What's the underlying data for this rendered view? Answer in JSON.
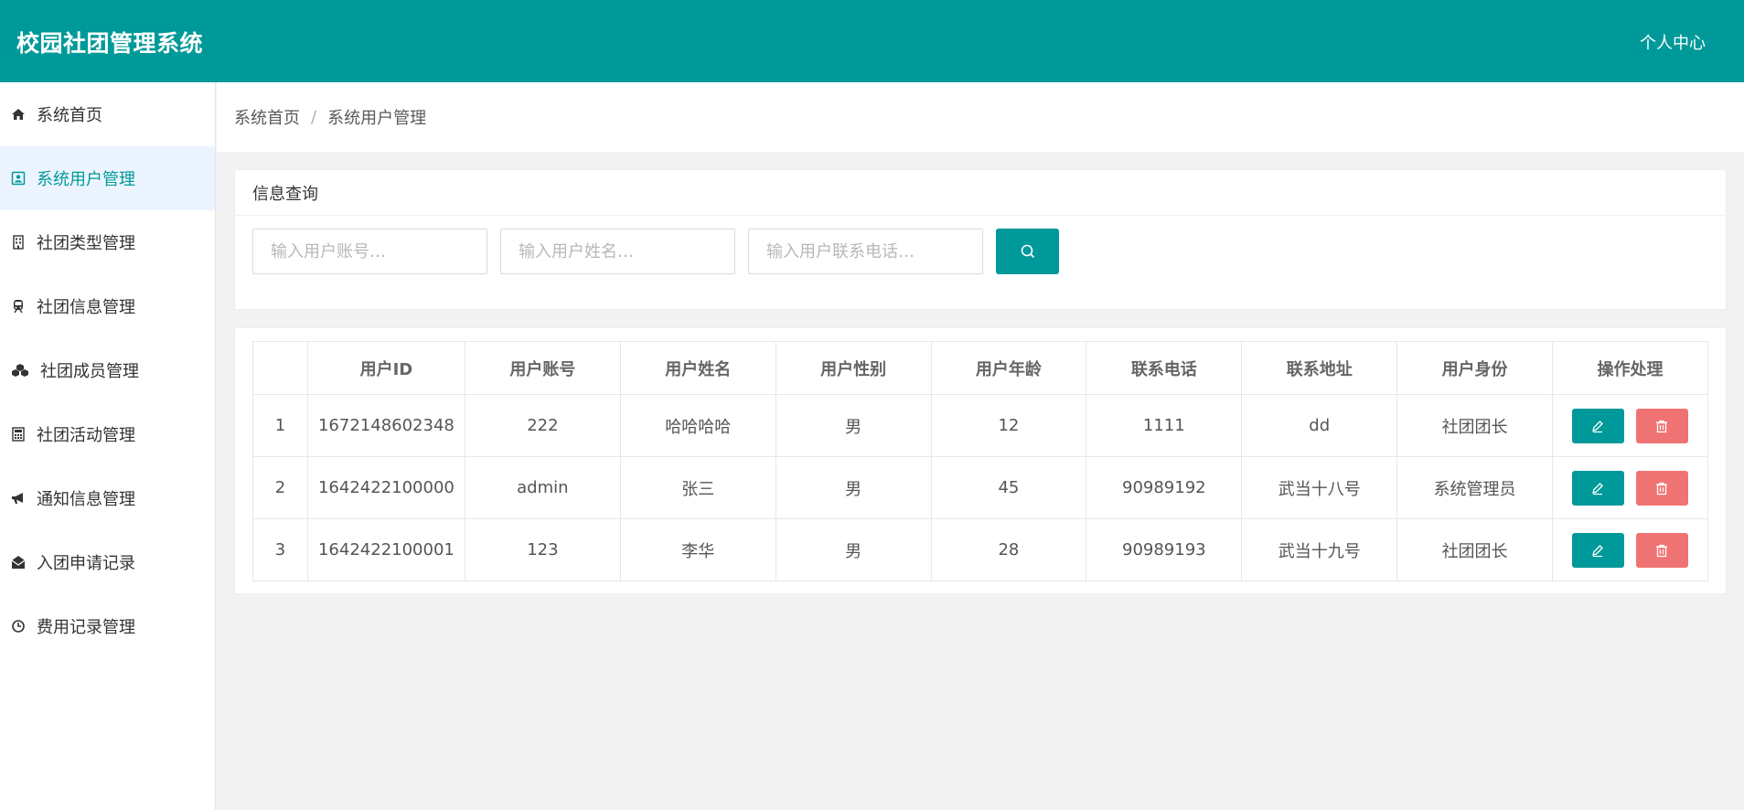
{
  "header": {
    "title": "校园社团管理系统",
    "user_center": "个人中心"
  },
  "sidebar": {
    "items": [
      {
        "label": "系统首页",
        "icon": "home-icon"
      },
      {
        "label": "系统用户管理",
        "icon": "user-card-icon",
        "active": true
      },
      {
        "label": "社团类型管理",
        "icon": "building-icon"
      },
      {
        "label": "社团信息管理",
        "icon": "train-icon"
      },
      {
        "label": "社团成员管理",
        "icon": "cubes-icon"
      },
      {
        "label": "社团活动管理",
        "icon": "calculator-icon"
      },
      {
        "label": "通知信息管理",
        "icon": "bullhorn-icon"
      },
      {
        "label": "入团申请记录",
        "icon": "envelope-open-icon"
      },
      {
        "label": "费用记录管理",
        "icon": "clock-icon"
      }
    ]
  },
  "breadcrumb": {
    "home": "系统首页",
    "separator": "/",
    "current": "系统用户管理"
  },
  "search": {
    "title": "信息查询",
    "account_placeholder": "输入用户账号…",
    "name_placeholder": "输入用户姓名…",
    "phone_placeholder": "输入用户联系电话…"
  },
  "table": {
    "headers": [
      "",
      "用户ID",
      "用户账号",
      "用户姓名",
      "用户性别",
      "用户年龄",
      "联系电话",
      "联系地址",
      "用户身份",
      "操作处理"
    ],
    "rows": [
      [
        "1",
        "1672148602348",
        "222",
        "哈哈哈哈",
        "男",
        "12",
        "1111",
        "dd",
        "社团团长"
      ],
      [
        "2",
        "1642422100000",
        "admin",
        "张三",
        "男",
        "45",
        "90989192",
        "武当十八号",
        "系统管理员"
      ],
      [
        "3",
        "1642422100001",
        "123",
        "李华",
        "男",
        "28",
        "90989193",
        "武当十九号",
        "社团团长"
      ]
    ]
  },
  "colors": {
    "primary": "#009999",
    "danger": "#f07373",
    "active_bg": "#ecf5ff"
  }
}
